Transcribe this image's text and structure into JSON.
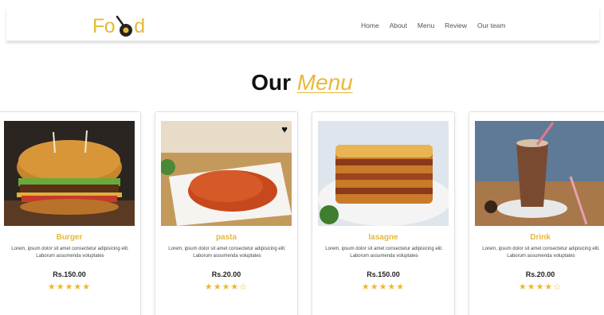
{
  "brand": {
    "logo_text_left": "Fo",
    "logo_text_right": "d",
    "accent_color": "#e8b83a"
  },
  "nav": {
    "items": [
      "Home",
      "About",
      "Menu",
      "Review",
      "Our team"
    ]
  },
  "title": {
    "main": "Our",
    "accent": "Menu"
  },
  "cards": [
    {
      "name": "Burger",
      "description": "Lorem, ipsum dolor sit amet consectetur adipisicing elit. Laborum assumenda voluptates",
      "price": "Rs.150.00",
      "stars": "★★★★★",
      "rating": 5,
      "image": "burger",
      "has_heart": false
    },
    {
      "name": "pasta",
      "description": "Lorem, ipsum dolor sit amet consectetur adipisicing elit. Laborum assumenda voluptates",
      "price": "Rs.20.00",
      "stars": "★★★★☆",
      "rating": 4.5,
      "image": "pasta",
      "has_heart": true
    },
    {
      "name": "lasagne",
      "description": "Lorem, ipsum dolor sit amet consectetur adipisicing elit. Laborum assumenda voluptates",
      "price": "Rs.150.00",
      "stars": "★★★★★",
      "rating": 5,
      "image": "lasagne",
      "has_heart": false
    },
    {
      "name": "Drink",
      "description": "Lorem, ipsum dolor sit amet consectetur adipisicing elit. Laborum assumenda voluptates",
      "price": "Rs.20.00",
      "stars": "★★★★☆",
      "rating": 4.5,
      "image": "drink",
      "has_heart": false
    }
  ]
}
